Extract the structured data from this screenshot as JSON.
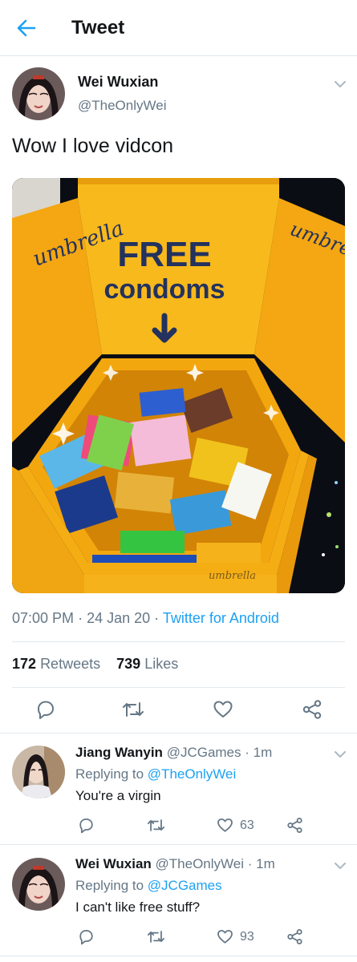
{
  "header": {
    "title": "Tweet"
  },
  "tweet": {
    "author_name": "Wei Wuxian",
    "author_handle": "@TheOnlyWei",
    "text": "Wow I love vidcon",
    "media": {
      "left_sign": "umbrella",
      "right_sign": "umbrella",
      "headline": "FREE",
      "subline": "condoms",
      "box_label": "umbrella"
    },
    "time": "07:00 PM",
    "date": "24 Jan 20",
    "separator": "·",
    "source": "Twitter for Android",
    "retweet_count": "172",
    "retweet_label": "Retweets",
    "like_count": "739",
    "like_label": "Likes"
  },
  "replies": [
    {
      "name": "Jiang Wanyin",
      "handle": "@JCGames",
      "time": "· 1m",
      "replying_prefix": "Replying to",
      "replying_to": "@TheOnlyWei",
      "text": "You're a virgin",
      "like_count": "63"
    },
    {
      "name": "Wei Wuxian",
      "handle": "@TheOnlyWei",
      "time": "· 1m",
      "replying_prefix": "Replying to",
      "replying_to": "@JCGames",
      "text": "I can't like free stuff?",
      "like_count": "93"
    }
  ],
  "icons": {
    "back": "arrow-left-icon",
    "chevron": "chevron-down-icon",
    "reply": "reply-icon",
    "retweet": "retweet-icon",
    "like": "heart-icon",
    "share": "share-icon"
  },
  "colors": {
    "accent": "#1da1f2",
    "text": "#14171a",
    "secondary": "#657786",
    "divider": "#e1e8ed",
    "media_yellow": "#f6b21b"
  }
}
